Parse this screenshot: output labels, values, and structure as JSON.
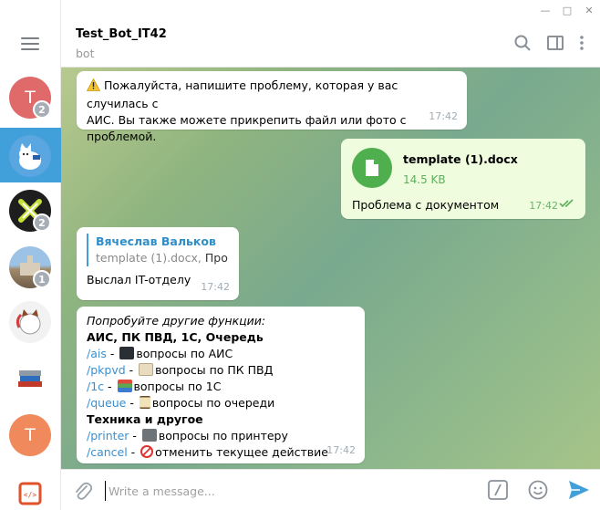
{
  "window": {
    "minimize": "—",
    "maximize": "□",
    "close": "✕"
  },
  "sidebar": {
    "chats": [
      {
        "initial": "T",
        "color": "#e06a6a",
        "badge": "2"
      },
      {
        "initial": "",
        "color": "#5aa6e0",
        "badge": "",
        "active": true
      },
      {
        "initial": "",
        "color": "#1e1e1e",
        "badge": "2"
      },
      {
        "initial": "",
        "color": "#6d8fb0",
        "badge": "1"
      },
      {
        "initial": "",
        "color": "#f2f2f2",
        "badge": ""
      },
      {
        "initial": "",
        "color": "#ffffff",
        "badge": ""
      },
      {
        "initial": "T",
        "color": "#f08a5d",
        "badge": ""
      },
      {
        "initial": "",
        "color": "#ffffff",
        "badge": ""
      }
    ]
  },
  "header": {
    "title": "Test_Bot_IT42",
    "subtitle": "bot"
  },
  "messages": {
    "m1": {
      "line1": "Пожалуйста, напишите проблему, которая у вас случилась с",
      "line2": "АИС. Вы также можете прикрепить файл или фото с проблемой.",
      "time": "17:42"
    },
    "m2": {
      "file_name": "template (1).docx",
      "file_size": "14.5 KB",
      "caption": "Проблема с документом",
      "time": "17:42"
    },
    "m3": {
      "reply_name": "Вячеслав Вальков",
      "reply_file": "template (1).docx,",
      "reply_text": "Про...",
      "text": "Выслал IT-отделу",
      "time": "17:42"
    },
    "m4": {
      "intro": "Попробуйте другие функции:",
      "section1": "АИС, ПК ПВД, 1С, Очередь",
      "items1": [
        {
          "cmd": "/ais",
          "sep": " - ",
          "text": "вопросы по АИС",
          "emoji_color": "#2a2f36"
        },
        {
          "cmd": "/pkpvd",
          "sep": " - ",
          "text": "вопросы по ПК ПВД",
          "emoji_color": "#e8dcc0"
        },
        {
          "cmd": "/1c",
          "sep": " - ",
          "text": "вопросы по 1С",
          "emoji_color": "#5aa84f"
        },
        {
          "cmd": "/queue",
          "sep": " - ",
          "text": "вопросы по очереди",
          "emoji_color": "#c9a46a"
        }
      ],
      "section2": "Техника и другое",
      "items2": [
        {
          "cmd": "/printer",
          "sep": " - ",
          "text": "вопросы по принтеру",
          "emoji_color": "#6e7378"
        },
        {
          "cmd": "/cancel",
          "sep": " - ",
          "text": "отменить текущее действие",
          "emoji_color": "#e0322f"
        }
      ],
      "time": "17:42"
    }
  },
  "composer": {
    "placeholder": "Write a message..."
  },
  "colors": {
    "accent": "#419fd9",
    "outgoing": "#effdde",
    "file": "#4fae4e"
  }
}
